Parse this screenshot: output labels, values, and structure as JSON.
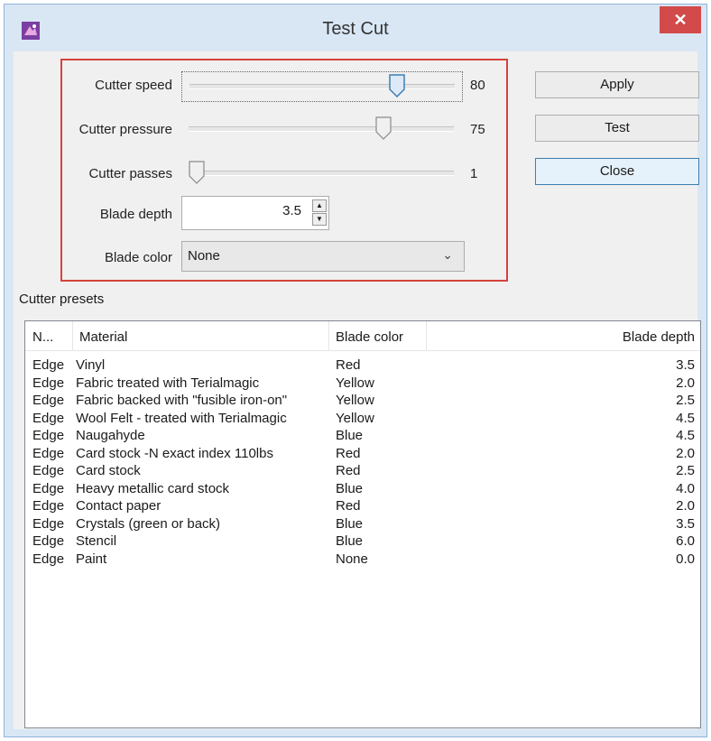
{
  "window": {
    "title": "Test Cut",
    "close_glyph": "✕"
  },
  "settings": {
    "speed": {
      "label": "Cutter speed",
      "value": "80",
      "fraction": 0.8
    },
    "pressure": {
      "label": "Cutter pressure",
      "value": "75",
      "fraction": 0.75
    },
    "passes": {
      "label": "Cutter passes",
      "value": "1",
      "fraction": 0.0
    },
    "depth": {
      "label": "Blade depth",
      "value": "3.5"
    },
    "color": {
      "label": "Blade color",
      "value": "None"
    }
  },
  "buttons": {
    "apply": "Apply",
    "test": "Test",
    "close": "Close"
  },
  "presets": {
    "label": "Cutter presets",
    "columns": [
      "N...",
      "Material",
      "Blade color",
      "Blade depth"
    ],
    "rows": [
      [
        "Edge",
        "Vinyl",
        "Red",
        "3.5"
      ],
      [
        "Edge",
        "Fabric treated with Terialmagic",
        "Yellow",
        "2.0"
      ],
      [
        "Edge",
        "Fabric backed with \"fusible iron-on\"",
        "Yellow",
        "2.5"
      ],
      [
        "Edge",
        "Wool Felt - treated with Terialmagic",
        "Yellow",
        "4.5"
      ],
      [
        "Edge",
        "Naugahyde",
        "Blue",
        "4.5"
      ],
      [
        "Edge",
        "Card stock -N exact index 110lbs",
        "Red",
        "2.0"
      ],
      [
        "Edge",
        "Card stock",
        "Red",
        "2.5"
      ],
      [
        "Edge",
        "Heavy metallic card stock",
        "Blue",
        "4.0"
      ],
      [
        "Edge",
        "Contact paper",
        "Red",
        "2.0"
      ],
      [
        "Edge",
        "Crystals (green or back)",
        "Blue",
        "3.5"
      ],
      [
        "Edge",
        "Stencil",
        "Blue",
        "6.0"
      ],
      [
        "Edge",
        "Paint",
        "None",
        "0.0"
      ]
    ]
  },
  "colors": {
    "highlight_border": "#d6423d",
    "close_button": "#d24a4a"
  }
}
